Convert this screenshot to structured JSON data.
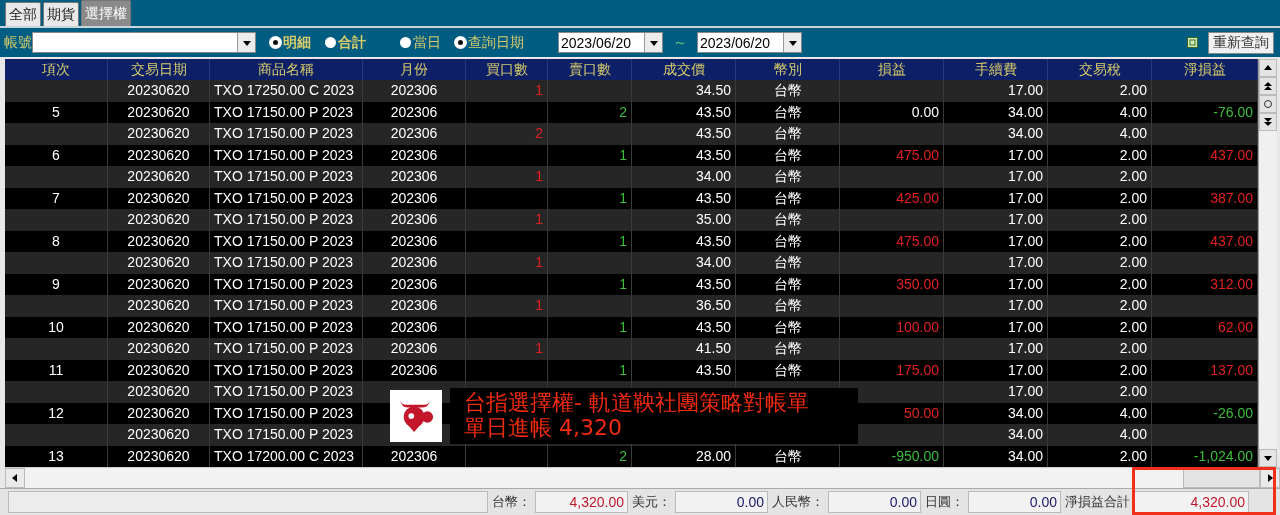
{
  "tabs": [
    {
      "label": "全部",
      "selected": false
    },
    {
      "label": "期貨",
      "selected": false
    },
    {
      "label": "選擇權",
      "selected": true
    }
  ],
  "toolbar": {
    "account_label": "帳號",
    "view_options": [
      {
        "label": "明細",
        "selected": true
      },
      {
        "label": "合計",
        "selected": false
      }
    ],
    "date_options": [
      {
        "label": "當日",
        "selected": false
      },
      {
        "label": "查詢日期",
        "selected": true
      }
    ],
    "date_from": "2023/06/20",
    "range_sep": "～",
    "date_to": "2023/06/20",
    "refresh_button": "重新查詢"
  },
  "table": {
    "columns": [
      "項次",
      "交易日期",
      "商品名稱",
      "月份",
      "買口數",
      "賣口數",
      "成交價",
      "幣別",
      "損益",
      "手續費",
      "交易稅",
      "淨損益"
    ],
    "rows": [
      {
        "cells": [
          "",
          "20230620",
          "TXO 17250.00 C 2023",
          "202306",
          {
            "text": "1",
            "color": "#e02020"
          },
          "",
          "34.50",
          "台幣",
          "",
          "17.00",
          "2.00",
          ""
        ]
      },
      {
        "cells": [
          "5",
          "20230620",
          "TXO 17150.00 P 2023",
          "202306",
          "",
          {
            "text": "2",
            "color": "#3cbc3c"
          },
          "43.50",
          "台幣",
          {
            "text": "0.00",
            "color": "#ffffff"
          },
          "34.00",
          "4.00",
          {
            "text": "-76.00",
            "color": "#3cbc3c"
          }
        ]
      },
      {
        "cells": [
          "",
          "20230620",
          "TXO 17150.00 P 2023",
          "202306",
          {
            "text": "2",
            "color": "#e02020"
          },
          "",
          "43.50",
          "台幣",
          "",
          "34.00",
          "4.00",
          ""
        ]
      },
      {
        "cells": [
          "6",
          "20230620",
          "TXO 17150.00 P 2023",
          "202306",
          "",
          {
            "text": "1",
            "color": "#3cbc3c"
          },
          "43.50",
          "台幣",
          {
            "text": "475.00",
            "color": "#e02020"
          },
          "17.00",
          "2.00",
          {
            "text": "437.00",
            "color": "#e02020"
          }
        ]
      },
      {
        "cells": [
          "",
          "20230620",
          "TXO 17150.00 P 2023",
          "202306",
          {
            "text": "1",
            "color": "#e02020"
          },
          "",
          "34.00",
          "台幣",
          "",
          "17.00",
          "2.00",
          ""
        ]
      },
      {
        "cells": [
          "7",
          "20230620",
          "TXO 17150.00 P 2023",
          "202306",
          "",
          {
            "text": "1",
            "color": "#3cbc3c"
          },
          "43.50",
          "台幣",
          {
            "text": "425.00",
            "color": "#e02020"
          },
          "17.00",
          "2.00",
          {
            "text": "387.00",
            "color": "#e02020"
          }
        ]
      },
      {
        "cells": [
          "",
          "20230620",
          "TXO 17150.00 P 2023",
          "202306",
          {
            "text": "1",
            "color": "#e02020"
          },
          "",
          "35.00",
          "台幣",
          "",
          "17.00",
          "2.00",
          ""
        ]
      },
      {
        "cells": [
          "8",
          "20230620",
          "TXO 17150.00 P 2023",
          "202306",
          "",
          {
            "text": "1",
            "color": "#3cbc3c"
          },
          "43.50",
          "台幣",
          {
            "text": "475.00",
            "color": "#e02020"
          },
          "17.00",
          "2.00",
          {
            "text": "437.00",
            "color": "#e02020"
          }
        ]
      },
      {
        "cells": [
          "",
          "20230620",
          "TXO 17150.00 P 2023",
          "202306",
          {
            "text": "1",
            "color": "#e02020"
          },
          "",
          "34.00",
          "台幣",
          "",
          "17.00",
          "2.00",
          ""
        ]
      },
      {
        "cells": [
          "9",
          "20230620",
          "TXO 17150.00 P 2023",
          "202306",
          "",
          {
            "text": "1",
            "color": "#3cbc3c"
          },
          "43.50",
          "台幣",
          {
            "text": "350.00",
            "color": "#e02020"
          },
          "17.00",
          "2.00",
          {
            "text": "312.00",
            "color": "#e02020"
          }
        ]
      },
      {
        "cells": [
          "",
          "20230620",
          "TXO 17150.00 P 2023",
          "202306",
          {
            "text": "1",
            "color": "#e02020"
          },
          "",
          "36.50",
          "台幣",
          "",
          "17.00",
          "2.00",
          ""
        ]
      },
      {
        "cells": [
          "10",
          "20230620",
          "TXO 17150.00 P 2023",
          "202306",
          "",
          {
            "text": "1",
            "color": "#3cbc3c"
          },
          "43.50",
          "台幣",
          {
            "text": "100.00",
            "color": "#e02020"
          },
          "17.00",
          "2.00",
          {
            "text": "62.00",
            "color": "#e02020"
          }
        ]
      },
      {
        "cells": [
          "",
          "20230620",
          "TXO 17150.00 P 2023",
          "202306",
          {
            "text": "1",
            "color": "#e02020"
          },
          "",
          "41.50",
          "台幣",
          "",
          "17.00",
          "2.00",
          ""
        ]
      },
      {
        "cells": [
          "11",
          "20230620",
          "TXO 17150.00 P 2023",
          "202306",
          "",
          {
            "text": "1",
            "color": "#3cbc3c"
          },
          "43.50",
          "台幣",
          {
            "text": "175.00",
            "color": "#e02020"
          },
          "17.00",
          "2.00",
          {
            "text": "137.00",
            "color": "#e02020"
          }
        ]
      },
      {
        "cells": [
          "",
          "20230620",
          "TXO 17150.00 P 2023",
          "",
          "",
          "",
          "",
          "",
          "",
          "17.00",
          "2.00",
          ""
        ]
      },
      {
        "cells": [
          "12",
          "20230620",
          "TXO 17150.00 P 2023",
          "",
          "",
          "",
          "",
          "",
          {
            "text": "50.00",
            "color": "#e02020"
          },
          "34.00",
          "4.00",
          {
            "text": "-26.00",
            "color": "#3cbc3c"
          }
        ]
      },
      {
        "cells": [
          "",
          "20230620",
          "TXO 17150.00 P 2023",
          "",
          "",
          "",
          "",
          "",
          "",
          "34.00",
          "4.00",
          ""
        ]
      },
      {
        "cells": [
          "13",
          "20230620",
          "TXO 17200.00 C 2023",
          "202306",
          "",
          {
            "text": "2",
            "color": "#3cbc3c"
          },
          "28.00",
          "台幣",
          {
            "text": "-950.00",
            "color": "#3cbc3c"
          },
          "34.00",
          "2.00",
          {
            "text": "-1,024.00",
            "color": "#3cbc3c"
          }
        ]
      }
    ]
  },
  "footer": {
    "totals": [
      {
        "label": "台幣：",
        "value": "4,320.00",
        "color": "#c0182a"
      },
      {
        "label": "美元：",
        "value": "0.00",
        "color": "#1a1a6a"
      },
      {
        "label": "人民幣：",
        "value": "0.00",
        "color": "#1a1a6a"
      },
      {
        "label": "日圓：",
        "value": "0.00",
        "color": "#1a1a6a"
      },
      {
        "label": "淨損益合計",
        "value": "4,320.00",
        "color": "#c0182a"
      }
    ]
  },
  "annotation": {
    "lines": [
      "台指選擇權- 軌道鞅社團策略對帳單",
      "單日進帳 4,320"
    ],
    "highlight_total": true
  }
}
